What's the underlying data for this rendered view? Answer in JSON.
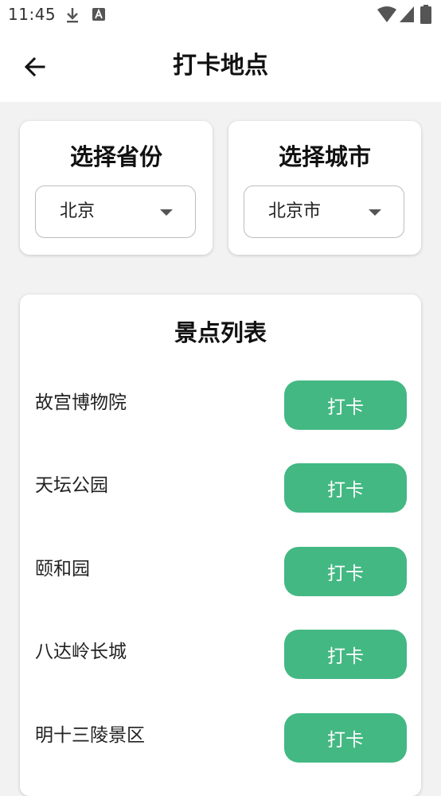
{
  "status_bar": {
    "time": "11:45",
    "icons": [
      "download-icon",
      "a-icon",
      "wifi-icon",
      "signal-icon",
      "battery-icon"
    ]
  },
  "app_bar": {
    "back_icon": "arrow-left-icon",
    "title": "打卡地点"
  },
  "province_card": {
    "heading": "选择省份",
    "selected": "北京"
  },
  "city_card": {
    "heading": "选择城市",
    "selected": "北京市"
  },
  "attractions": {
    "heading": "景点列表",
    "button_label": "打卡",
    "items": [
      {
        "name": "故宫博物院"
      },
      {
        "name": "天坛公园"
      },
      {
        "name": "颐和园"
      },
      {
        "name": "八达岭长城"
      },
      {
        "name": "明十三陵景区"
      }
    ]
  },
  "colors": {
    "accent": "#43b883",
    "background": "#f2f2f2",
    "card": "#ffffff"
  }
}
